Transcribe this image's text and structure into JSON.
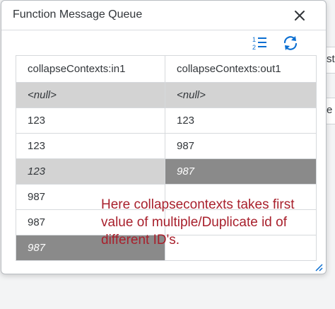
{
  "dialog": {
    "title": "Function Message Queue",
    "close_icon": "close-icon",
    "toolbar": {
      "sort_icon": "sort-list-icon",
      "refresh_icon": "refresh-icon"
    },
    "table": {
      "columns": [
        "collapseContexts:in1",
        "collapseContexts:out1"
      ],
      "rows": [
        {
          "in1": "<null>",
          "out1": "<null>"
        },
        {
          "in1": "123",
          "out1": "123"
        },
        {
          "in1": "123",
          "out1": "987"
        },
        {
          "in1": "123",
          "out1": "987"
        },
        {
          "in1": "987",
          "out1": ""
        },
        {
          "in1": "987",
          "out1": ""
        },
        {
          "in1": "987",
          "out1": ""
        }
      ]
    },
    "annotation": "Here collapsecontexts takes first value of multiple/Duplicate id of different ID's."
  },
  "background": {
    "fragment_a": "st",
    "fragment_b": "e"
  },
  "colors": {
    "annotation": "#a8202c",
    "accent": "#0a6ed1",
    "row_light": "#d3d3d3",
    "row_dark": "#8a8a8a"
  }
}
